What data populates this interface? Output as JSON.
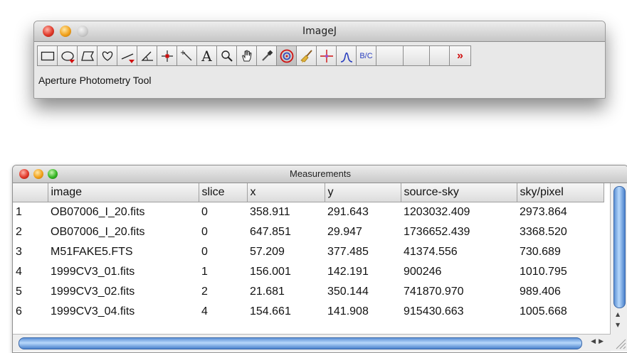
{
  "imagej": {
    "title": "ImageJ",
    "status": "Aperture Photometry Tool",
    "tools": [
      {
        "name": "rectangle-tool-icon"
      },
      {
        "name": "oval-tool-icon"
      },
      {
        "name": "polygon-tool-icon"
      },
      {
        "name": "freehand-tool-icon"
      },
      {
        "name": "line-tool-icon"
      },
      {
        "name": "angle-tool-icon"
      },
      {
        "name": "point-tool-icon"
      },
      {
        "name": "wand-tool-icon"
      },
      {
        "name": "text-tool-icon",
        "label": "A"
      },
      {
        "name": "magnifier-tool-icon"
      },
      {
        "name": "hand-tool-icon"
      },
      {
        "name": "dropper-tool-icon"
      },
      {
        "name": "aperture-tool-icon"
      },
      {
        "name": "broom-tool-icon"
      },
      {
        "name": "star-tool-icon"
      },
      {
        "name": "profile-tool-icon"
      },
      {
        "name": "bc-tool",
        "label": "B/C"
      }
    ],
    "more_label": "»"
  },
  "measurements": {
    "title": "Measurements",
    "columns": [
      "",
      "image",
      "slice",
      "x",
      "y",
      "source-sky",
      "sky/pixel"
    ],
    "rows": [
      [
        "1",
        "OB07006_I_20.fits",
        "0",
        "358.911",
        "291.643",
        "1203032.409",
        "2973.864"
      ],
      [
        "2",
        "OB07006_I_20.fits",
        "0",
        "647.851",
        "29.947",
        "1736652.439",
        "3368.520"
      ],
      [
        "3",
        "M51FAKE5.FTS",
        "0",
        "57.209",
        "377.485",
        "41374.556",
        "730.689"
      ],
      [
        "4",
        "1999CV3_01.fits",
        "1",
        "156.001",
        "142.191",
        "900246",
        "1010.795"
      ],
      [
        "5",
        "1999CV3_02.fits",
        "2",
        "21.681",
        "350.144",
        "741870.970",
        "989.406"
      ],
      [
        "6",
        "1999CV3_04.fits",
        "4",
        "154.661",
        "141.908",
        "915430.663",
        "1005.668"
      ]
    ]
  },
  "colors": {
    "accent_red": "#d01010",
    "accent_blue": "#2a3fbf",
    "scroll_blue": "#5f93d6"
  }
}
